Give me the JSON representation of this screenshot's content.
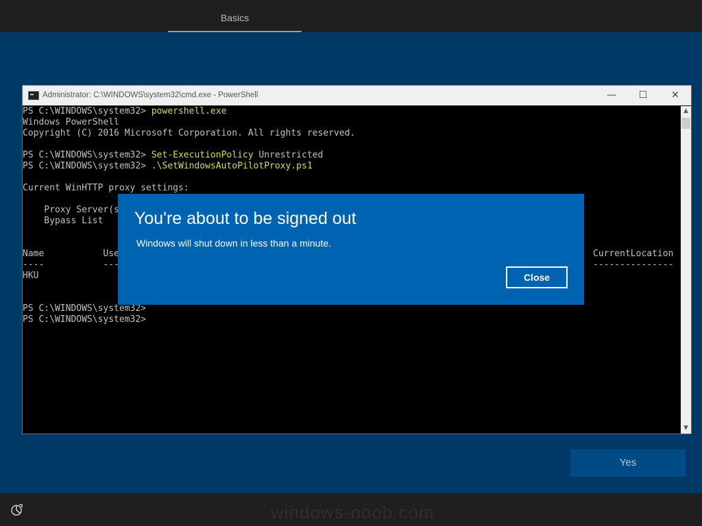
{
  "header": {
    "tab_label": "Basics"
  },
  "window": {
    "title": "Administrator: C:\\WINDOWS\\system32\\cmd.exe - PowerShell",
    "minimize_glyph": "—",
    "maximize_glyph": "☐",
    "close_glyph": "✕"
  },
  "console": {
    "lines": [
      {
        "prompt": "PS C:\\WINDOWS\\system32> ",
        "cmd": "powershell.exe"
      },
      {
        "text": "Windows PowerShell"
      },
      {
        "text": "Copyright (C) 2016 Microsoft Corporation. All rights reserved."
      },
      {
        "text": ""
      },
      {
        "prompt": "PS C:\\WINDOWS\\system32> ",
        "cmd": "Set-ExecutionPolicy",
        "arg": " Unrestricted"
      },
      {
        "prompt": "PS C:\\WINDOWS\\system32> ",
        "cmd": ".\\SetWindowsAutoPilotProxy.ps1"
      },
      {
        "text": ""
      },
      {
        "text": "Current WinHTTP proxy settings:"
      },
      {
        "text": ""
      },
      {
        "text": "    Proxy Server(s"
      },
      {
        "text": "    Bypass List"
      },
      {
        "text": ""
      },
      {
        "text": ""
      },
      {
        "text": "Name           Use"
      },
      {
        "text": "----           ---"
      },
      {
        "text": "HKU"
      },
      {
        "text": ""
      },
      {
        "text": ""
      },
      {
        "text": "PS C:\\WINDOWS\\system32>"
      },
      {
        "text": "PS C:\\WINDOWS\\system32>"
      }
    ],
    "right_header": "CurrentLocation",
    "right_dashes": "---------------"
  },
  "dialog": {
    "heading": "You're about to be signed out",
    "message": "Windows will shut down in less than a minute.",
    "close_label": "Close"
  },
  "footer": {
    "yes_label": "Yes",
    "watermark": "windows-noob.com",
    "accessibility_icon": "ease-of-access-icon"
  },
  "colors": {
    "background": "#003965",
    "dialog": "#0063b1",
    "command": "#dcdc4a",
    "console_text": "#c0c0c0"
  }
}
